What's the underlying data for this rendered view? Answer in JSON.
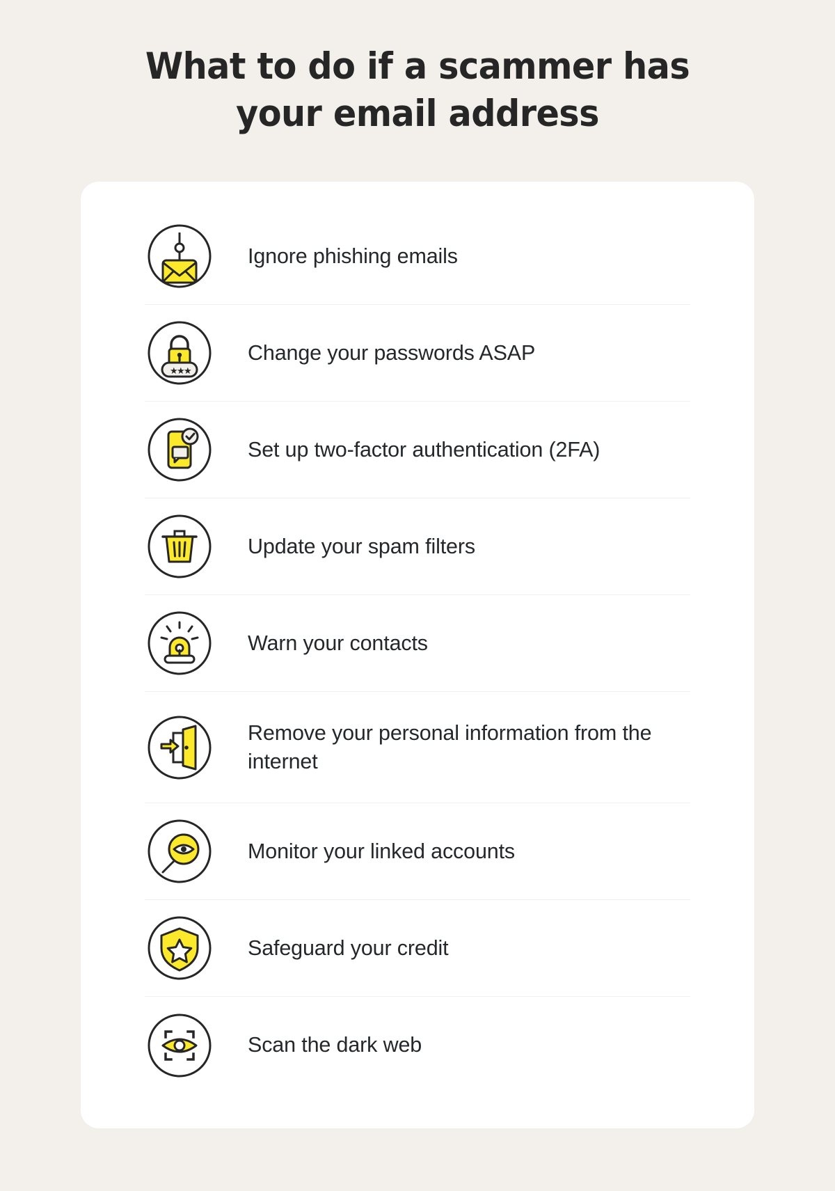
{
  "header": {
    "title_line1": "What to do if a scammer has",
    "title_line2": "your email address"
  },
  "colors": {
    "background": "#F3F0EB",
    "card": "#FFFFFF",
    "accent_yellow": "#FCE92B",
    "outline_dark": "#262626",
    "text": "#25282B",
    "divider": "#F4EFEA"
  },
  "checklist": {
    "items": [
      {
        "icon": "phishing-email-icon",
        "label": "Ignore phishing emails"
      },
      {
        "icon": "padlock-password-icon",
        "label": "Change your passwords ASAP"
      },
      {
        "icon": "two-factor-phone-icon",
        "label": "Set up two-factor authentication (2FA)"
      },
      {
        "icon": "trash-can-icon",
        "label": "Update your spam filters"
      },
      {
        "icon": "siren-alarm-icon",
        "label": "Warn your contacts"
      },
      {
        "icon": "exit-door-icon",
        "label": "Remove your personal information from the internet"
      },
      {
        "icon": "magnifier-eye-icon",
        "label": "Monitor your linked accounts"
      },
      {
        "icon": "shield-star-icon",
        "label": "Safeguard your credit"
      },
      {
        "icon": "scan-eye-icon",
        "label": "Scan the dark web"
      }
    ]
  }
}
